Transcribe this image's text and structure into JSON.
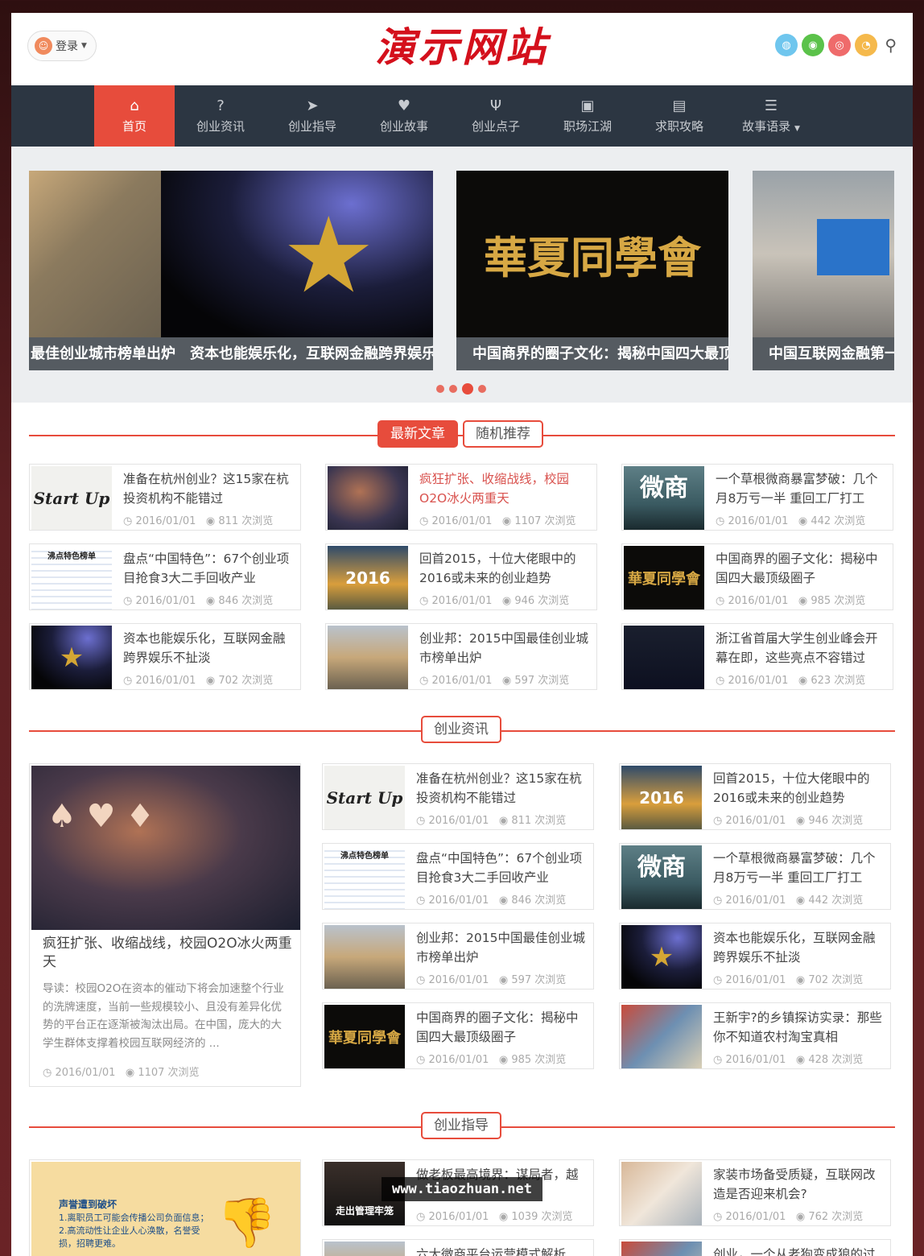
{
  "header": {
    "login_label": "登录",
    "logo_text": "演示网站",
    "social_icons": [
      "qq-icon",
      "wechat-icon",
      "weibo-icon",
      "rss-icon"
    ],
    "accent": "#e74c3c",
    "nav_bg": "#2c3642"
  },
  "nav": {
    "items": [
      {
        "label": "首页",
        "icon": "home-icon",
        "glyph": "⌂"
      },
      {
        "label": "创业资讯",
        "icon": "question-icon",
        "glyph": "?"
      },
      {
        "label": "创业指导",
        "icon": "paper-plane-icon",
        "glyph": "➤"
      },
      {
        "label": "创业故事",
        "icon": "heart-icon",
        "glyph": "♥"
      },
      {
        "label": "创业点子",
        "icon": "cutlery-icon",
        "glyph": "Ψ"
      },
      {
        "label": "职场江湖",
        "icon": "cup-icon",
        "glyph": "▣"
      },
      {
        "label": "求职攻略",
        "icon": "file-icon",
        "glyph": "▤"
      },
      {
        "label": "故事语录",
        "icon": "list-icon",
        "glyph": "☰"
      }
    ]
  },
  "slider": {
    "captions": [
      "最佳创业城市榜单出炉",
      "资本也能娱乐化，互联网金融跨界娱乐不扯淡",
      "中国商界的圈子文化：揭秘中国四大最顶级圈子",
      "中国互联网金融第一股"
    ],
    "slide2_text": "華夏同學會"
  },
  "sections": {
    "latest": {
      "tab_active": "最新文章",
      "tab_other": "随机推荐"
    },
    "news": {
      "title": "创业资讯"
    },
    "guide": {
      "title": "创业指导"
    }
  },
  "latest_articles": [
    {
      "title": "准备在杭州创业？这15家在杭投资机构不能错过",
      "date": "2016/01/01",
      "views": "811 次浏览"
    },
    {
      "title": "疯狂扩张、收缩战线，校园O2O冰火两重天",
      "date": "2016/01/01",
      "views": "1107 次浏览"
    },
    {
      "title": "一个草根微商暴富梦破：几个月8万亏一半 重回工厂打工",
      "date": "2016/01/01",
      "views": "442 次浏览"
    },
    {
      "title": "盘点“中国特色”：67个创业项目抢食3大二手回收产业",
      "date": "2016/01/01",
      "views": "846 次浏览"
    },
    {
      "title": "回首2015，十位大佬眼中的2016或未来的创业趋势",
      "date": "2016/01/01",
      "views": "946 次浏览"
    },
    {
      "title": "中国商界的圈子文化：揭秘中国四大最顶级圈子",
      "date": "2016/01/01",
      "views": "985 次浏览"
    },
    {
      "title": "资本也能娱乐化，互联网金融跨界娱乐不扯淡",
      "date": "2016/01/01",
      "views": "702 次浏览"
    },
    {
      "title": "创业邦：2015中国最佳创业城市榜单出炉",
      "date": "2016/01/01",
      "views": "597 次浏览"
    },
    {
      "title": "浙江省首届大学生创业峰会开幕在即，这些亮点不容错过",
      "date": "2016/01/01",
      "views": "623 次浏览"
    }
  ],
  "news_feature": {
    "title": "疯狂扩张、收缩战线，校园O2O冰火两重天",
    "desc": "导读：校园O2O在资本的催动下将会加速整个行业的洗牌速度，当前一些规模较小、且没有差异化优势的平台正在逐渐被淘汰出局。在中国，庞大的大学生群体支撑着校园互联网经济的 ...",
    "date": "2016/01/01",
    "views": "1107 次浏览"
  },
  "news_articles": [
    {
      "title": "准备在杭州创业？这15家在杭投资机构不能错过",
      "date": "2016/01/01",
      "views": "811 次浏览"
    },
    {
      "title": "回首2015，十位大佬眼中的2016或未来的创业趋势",
      "date": "2016/01/01",
      "views": "946 次浏览"
    },
    {
      "title": "盘点“中国特色”：67个创业项目抢食3大二手回收产业",
      "date": "2016/01/01",
      "views": "846 次浏览"
    },
    {
      "title": "一个草根微商暴富梦破：几个月8万亏一半 重回工厂打工",
      "date": "2016/01/01",
      "views": "442 次浏览"
    },
    {
      "title": "创业邦：2015中国最佳创业城市榜单出炉",
      "date": "2016/01/01",
      "views": "597 次浏览"
    },
    {
      "title": "资本也能娱乐化，互联网金融跨界娱乐不扯淡",
      "date": "2016/01/01",
      "views": "702 次浏览"
    },
    {
      "title": "中国商界的圈子文化：揭秘中国四大最顶级圈子",
      "date": "2016/01/01",
      "views": "985 次浏览"
    },
    {
      "title": "王新宇?的乡镇探访实录：那些你不知道农村淘宝真相",
      "date": "2016/01/01",
      "views": "428 次浏览"
    }
  ],
  "guide_articles": [
    {
      "title": "做老板最高境界：谋局者，越",
      "date": "2016/01/01",
      "views": "1039 次浏览"
    },
    {
      "title": "家装市场备受质疑，互联网改造是否迎来机会?",
      "date": "2016/01/01",
      "views": "762 次浏览"
    },
    {
      "title": "六大微商平台运营模式解析",
      "date": "",
      "views": ""
    },
    {
      "title": "创业，一个从老狗变成狼的过",
      "date": "",
      "views": ""
    }
  ],
  "guide_feature_text": {
    "line1": "声誉遭到破坏",
    "line2": "1.离职员工可能会传播公司负面信息；",
    "line3": "2.高流动性让企业人心涣散，名誉受损，招聘更难。"
  },
  "watermark": "www.tiaozhuan.net",
  "thumb_labels": {
    "startup": "Start Up",
    "weishang": "微商",
    "huaxia": "華夏同學會",
    "y2016": "2016",
    "pandian": "沸点特色榜单",
    "boss": "走出管理牢笼"
  }
}
